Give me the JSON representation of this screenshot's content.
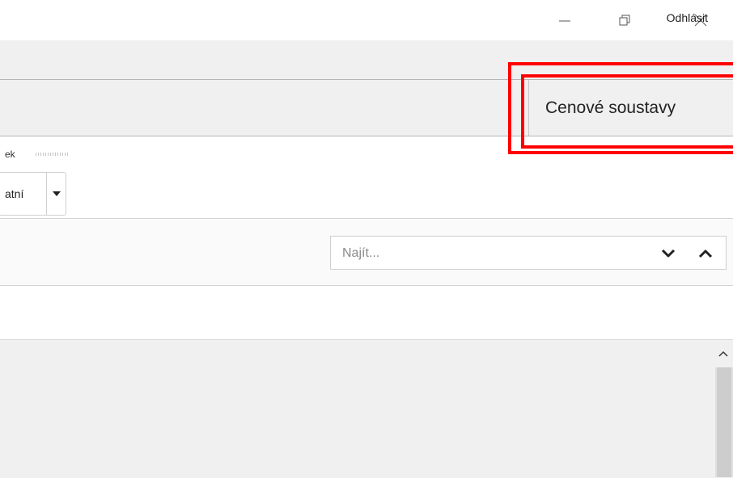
{
  "window": {
    "minimize_icon": "minimize-icon",
    "restore_icon": "restore-icon",
    "close_icon": "close-icon"
  },
  "topbar": {
    "logout_label": "Odhlásit"
  },
  "tabs": {
    "active_label": "Cenové soustavy"
  },
  "ribbon": {
    "group_label": "ek",
    "dropdown_label": "atní",
    "dropdown_icon": "caret-down-icon"
  },
  "search": {
    "placeholder": "Najít...",
    "value": "",
    "next_icon": "chevron-down-icon",
    "prev_icon": "chevron-up-icon"
  },
  "panel": {
    "scroll_up_icon": "scroll-up-icon"
  },
  "colors": {
    "highlight": "#ff0000",
    "bar_bg": "#f0f0f0",
    "border": "#b5b5b5"
  }
}
